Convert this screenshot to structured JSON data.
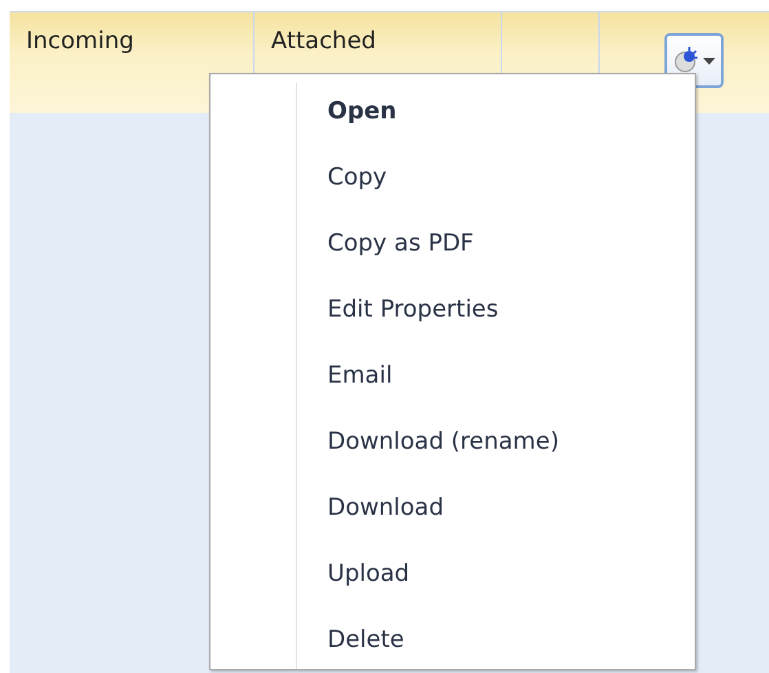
{
  "columns": [
    {
      "label": "Incoming"
    },
    {
      "label": "Attached"
    },
    {}
  ],
  "actions_button": {
    "kind": "dropdown"
  },
  "menu": {
    "items": [
      {
        "label": "Open",
        "default": true
      },
      {
        "label": "Copy",
        "default": false
      },
      {
        "label": "Copy as PDF",
        "default": false
      },
      {
        "label": "Edit Properties",
        "default": false
      },
      {
        "label": "Email",
        "default": false
      },
      {
        "label": "Download (rename)",
        "default": false
      },
      {
        "label": "Download",
        "default": false
      },
      {
        "label": "Upload",
        "default": false
      },
      {
        "label": "Delete",
        "default": false
      }
    ]
  }
}
